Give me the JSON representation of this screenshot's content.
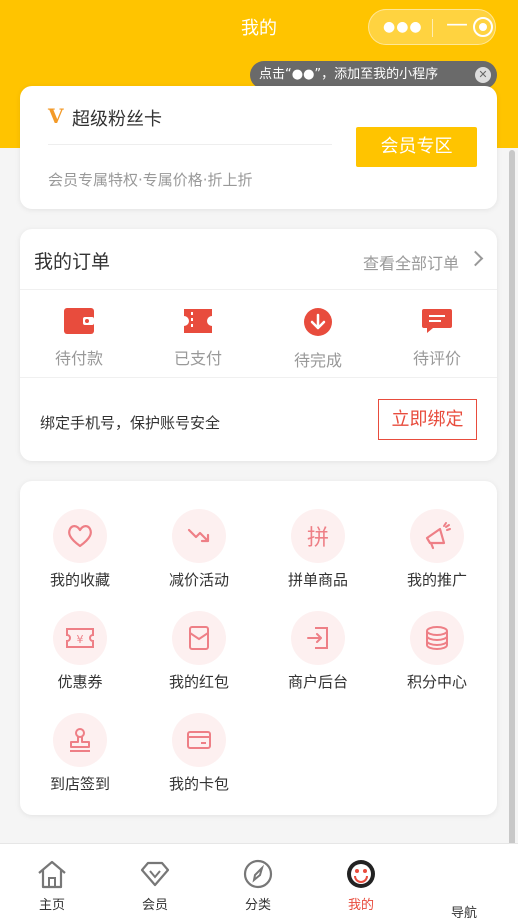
{
  "header": {
    "title": "我的",
    "bg_color": "#ffc400",
    "capsule": {
      "more_icon": "more-dots-icon",
      "minimize_icon": "minus-icon",
      "close_icon": "target-icon"
    },
    "tip": {
      "text": "点击“●●”，添加至我的小程序",
      "close_glyph": "✕"
    }
  },
  "fan_card": {
    "badge": "V",
    "title": "超级粉丝卡",
    "desc": "会员专属特权·专属价格·折上折",
    "button": "会员专区"
  },
  "orders": {
    "title": "我的订单",
    "view_all": "查看全部订单",
    "items": [
      {
        "label": "待付款",
        "icon": "wallet-icon"
      },
      {
        "label": "已支付",
        "icon": "ticket-icon"
      },
      {
        "label": "待完成",
        "icon": "arrow-down-circle-icon"
      },
      {
        "label": "待评价",
        "icon": "comment-icon"
      }
    ],
    "bind_text": "绑定手机号，保护账号安全",
    "bind_button": "立即绑定",
    "accent_color": "#e84c3d"
  },
  "services": {
    "items": [
      {
        "label": "我的收藏",
        "icon": "heart-icon"
      },
      {
        "label": "减价活动",
        "icon": "trend-down-icon"
      },
      {
        "label": "拼单商品",
        "icon": "pin-icon",
        "glyph": "拼"
      },
      {
        "label": "我的推广",
        "icon": "megaphone-icon"
      },
      {
        "label": "优惠券",
        "icon": "coupon-icon"
      },
      {
        "label": "我的红包",
        "icon": "red-envelope-icon"
      },
      {
        "label": "商户后台",
        "icon": "login-icon"
      },
      {
        "label": "积分中心",
        "icon": "coins-icon"
      },
      {
        "label": "到店签到",
        "icon": "stamp-icon"
      },
      {
        "label": "我的卡包",
        "icon": "card-icon"
      }
    ]
  },
  "tabbar": {
    "items": [
      {
        "label": "主页",
        "icon": "home-icon",
        "active": false
      },
      {
        "label": "会员",
        "icon": "diamond-icon",
        "active": false
      },
      {
        "label": "分类",
        "icon": "compass-icon",
        "active": false
      },
      {
        "label": "我的",
        "icon": "smiley-icon",
        "active": true
      },
      {
        "label": "导航",
        "icon": "navigation-icon",
        "active": false
      }
    ]
  }
}
